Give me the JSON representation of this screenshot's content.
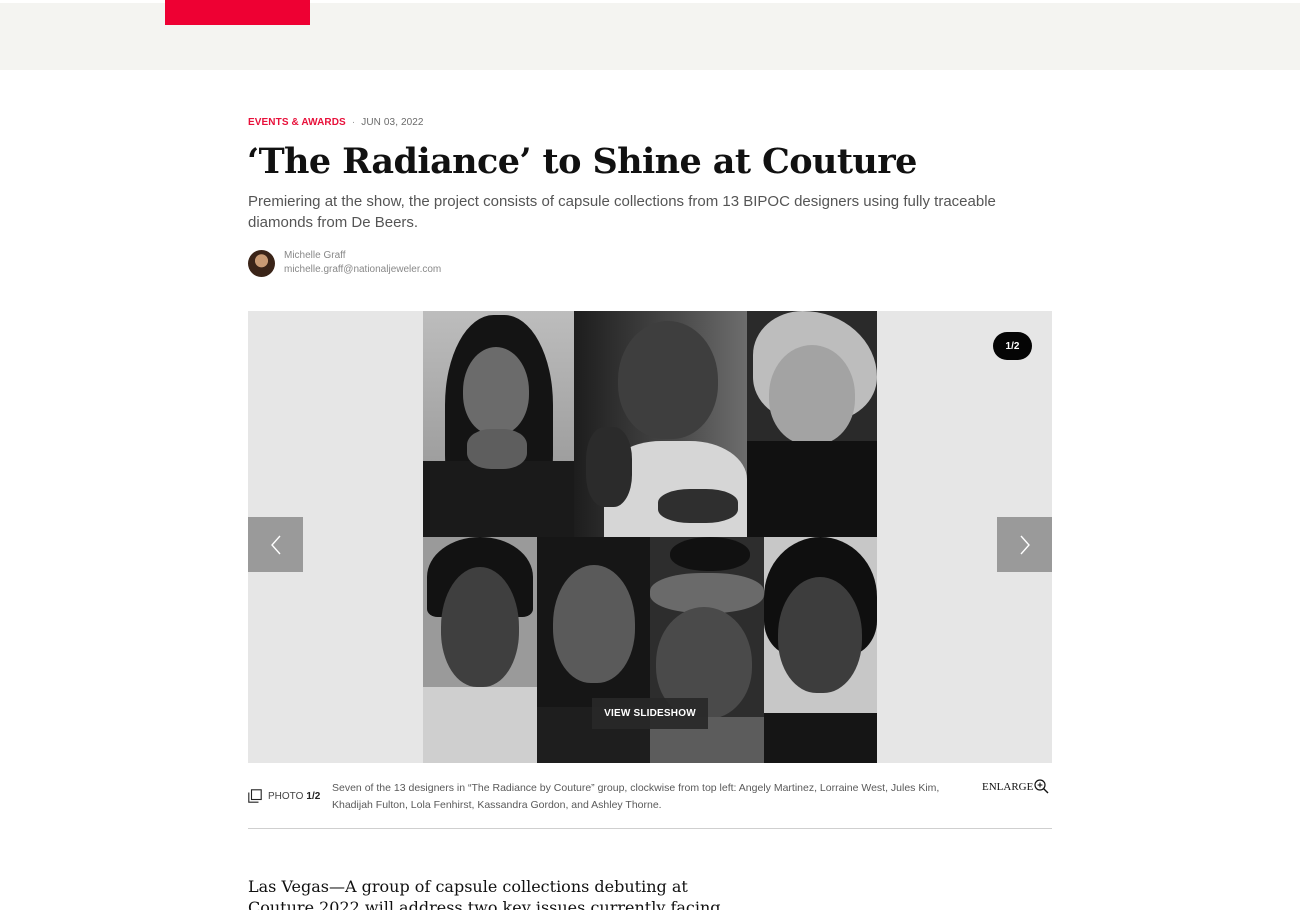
{
  "header": {
    "brand_color": "#ee0033"
  },
  "article": {
    "category": "EVENTS & AWARDS",
    "separator": "·",
    "date": "JUN 03, 2022",
    "headline": "‘The Radiance’ to Shine at Couture",
    "dek": "Premiering at the show, the project consists of capsule collections from 13 BIPOC designers using fully traceable diamonds from De Beers.",
    "author": {
      "name": "Michelle Graff",
      "email": "michelle.graff@nationaljeweler.com"
    },
    "body_lead": "Las Vegas—A group of capsule collections debuting at Couture 2022 will address two key issues currently facing the fine"
  },
  "gallery": {
    "counter": "1/2",
    "view_slideshow_label": "VIEW SLIDESHOW",
    "prev_icon": "chevron-left-icon",
    "next_icon": "chevron-right-icon",
    "photo_label": "PHOTO",
    "photo_number": "1/2",
    "caption": "Seven of the 13 designers in “The Radiance by Couture” group, clockwise from top left: Angely Martinez, Lorraine West, Jules Kim, Khadijah Fulton, Lola Fenhirst, Kassandra Gordon, and Ashley Thorne.",
    "enlarge_label": "ENLARGE",
    "enlarge_icon": "zoom-in-icon"
  }
}
